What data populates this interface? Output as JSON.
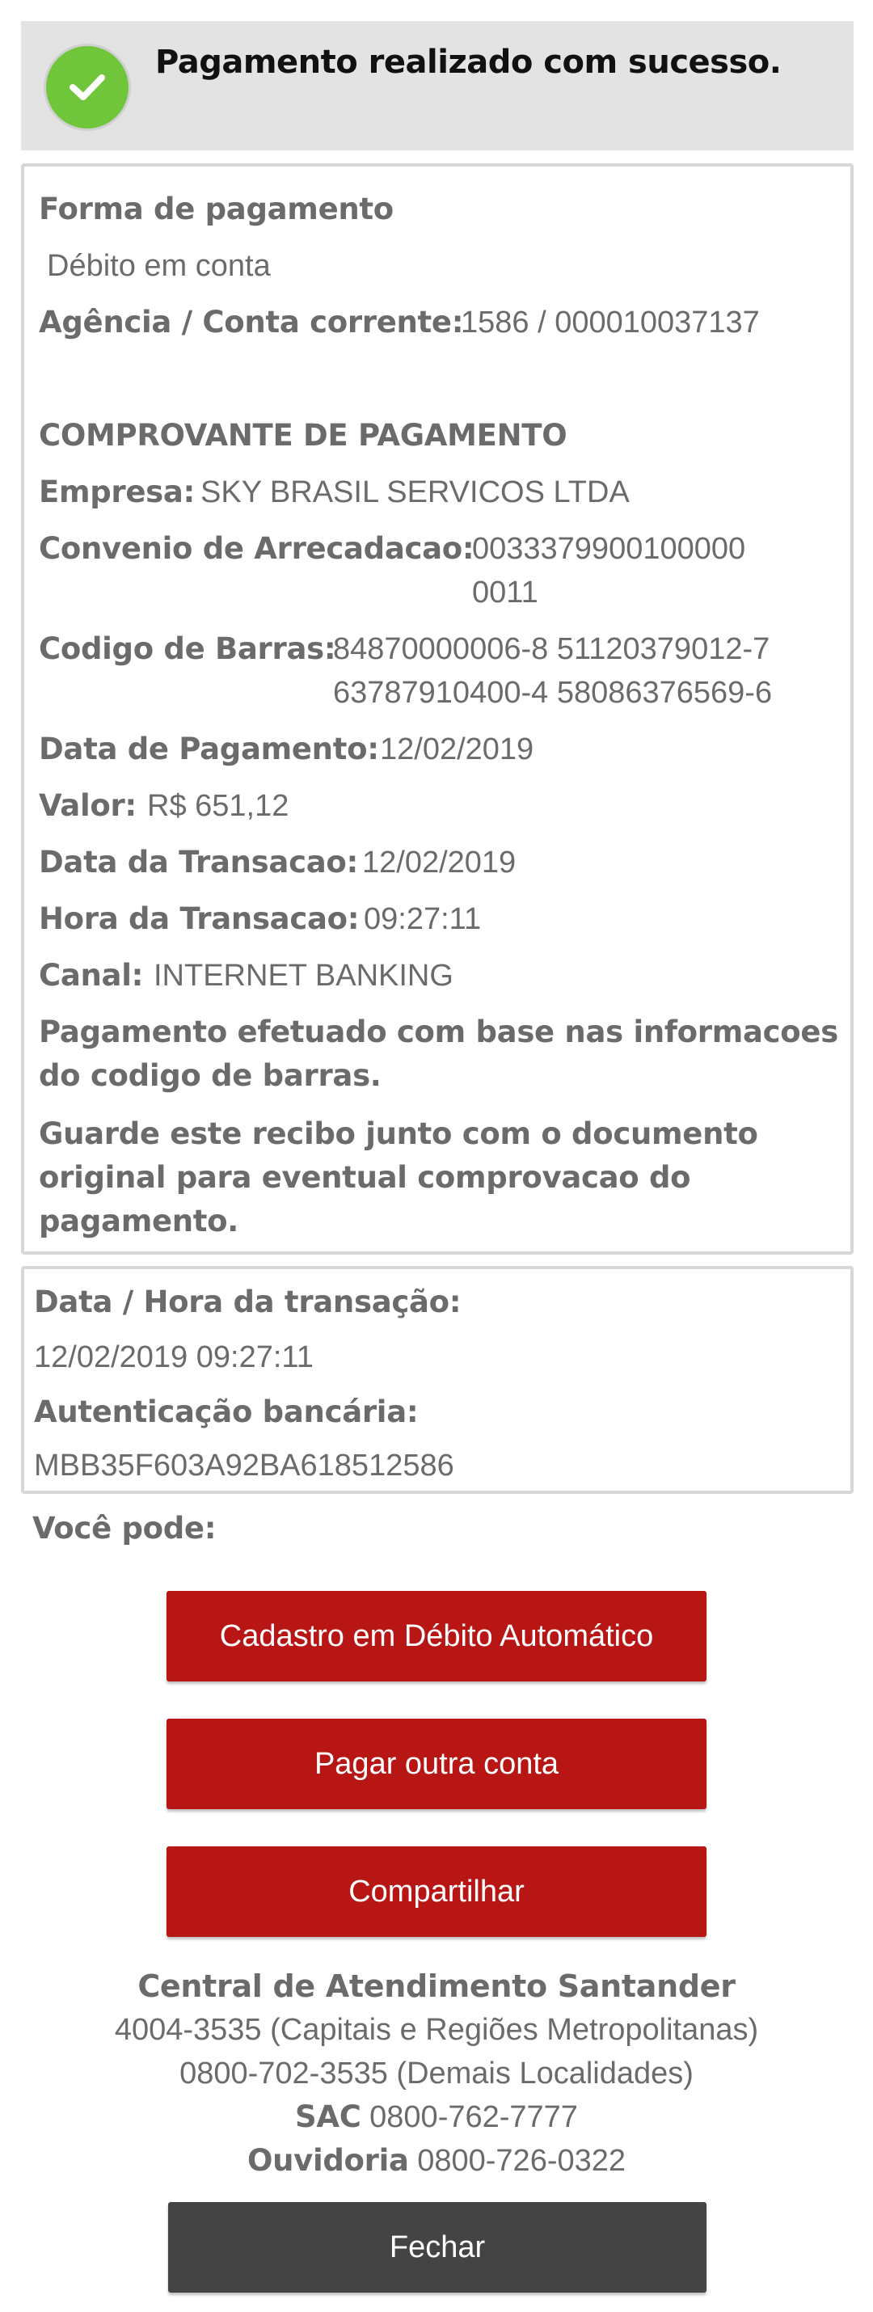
{
  "header": {
    "success_message": "Pagamento realizado com sucesso."
  },
  "payment_info": {
    "method_label": "Forma de pagamento",
    "method_value": "Débito em conta",
    "account_label": "Agência / Conta corrente:",
    "account_value": "1586 / 000010037137"
  },
  "receipt": {
    "title": "COMPROVANTE DE PAGAMENTO",
    "empresa_label": "Empresa:",
    "empresa_value": "SKY BRASIL SERVICOS LTDA",
    "convenio_label": "Convenio de Arrecadacao:",
    "convenio_value_line1": "0033379900100000",
    "convenio_value_line2": "0011",
    "barcode_label": "Codigo de Barras:",
    "barcode_line1": "84870000006-8 51120379012-7",
    "barcode_line2": "63787910400-4 58086376569-6",
    "payment_date_label": "Data de Pagamento:",
    "payment_date_value": "12/02/2019",
    "amount_label": "Valor:",
    "amount_value": "R$ 651,12",
    "transaction_date_label": "Data da Transacao:",
    "transaction_date_value": "12/02/2019",
    "transaction_time_label": "Hora da Transacao:",
    "transaction_time_value": "09:27:11",
    "channel_label": "Canal:",
    "channel_value": "INTERNET BANKING",
    "note1_line1": "Pagamento efetuado com base nas informacoes",
    "note1_line2": "do codigo de barras.",
    "note2_line1": "Guarde este recibo junto com o documento",
    "note2_line2": "original para eventual comprovacao do",
    "note2_line3": "pagamento."
  },
  "authentication": {
    "datetime_label": "Data / Hora da transação:",
    "datetime_value": "12/02/2019 09:27:11",
    "auth_label": "Autenticação bancária:",
    "auth_value": "MBB35F603A92BA618512586"
  },
  "actions": {
    "intro": "Você pode:",
    "auto_debit_button": "Cadastro em Débito Automático",
    "pay_other_button": "Pagar outra conta",
    "share_button": "Compartilhar",
    "close_button": "Fechar"
  },
  "support": {
    "title": "Central de Atendimento Santander",
    "capitals_phone": "4004-3535 (Capitais e Regiões Metropolitanas)",
    "other_phone": "0800-702-3535 (Demais Localidades)",
    "sac_label": "SAC",
    "sac_phone": "0800-762-7777",
    "ouvidoria_label": "Ouvidoria",
    "ouvidoria_phone": "0800-726-0322"
  },
  "colors": {
    "success_green": "#70c63a",
    "button_red": "#b81515",
    "button_dark": "#444444",
    "text_gray": "#6b6b6b",
    "banner_bg": "#e3e3e3"
  },
  "icons": {
    "success": "checkmark-icon"
  }
}
